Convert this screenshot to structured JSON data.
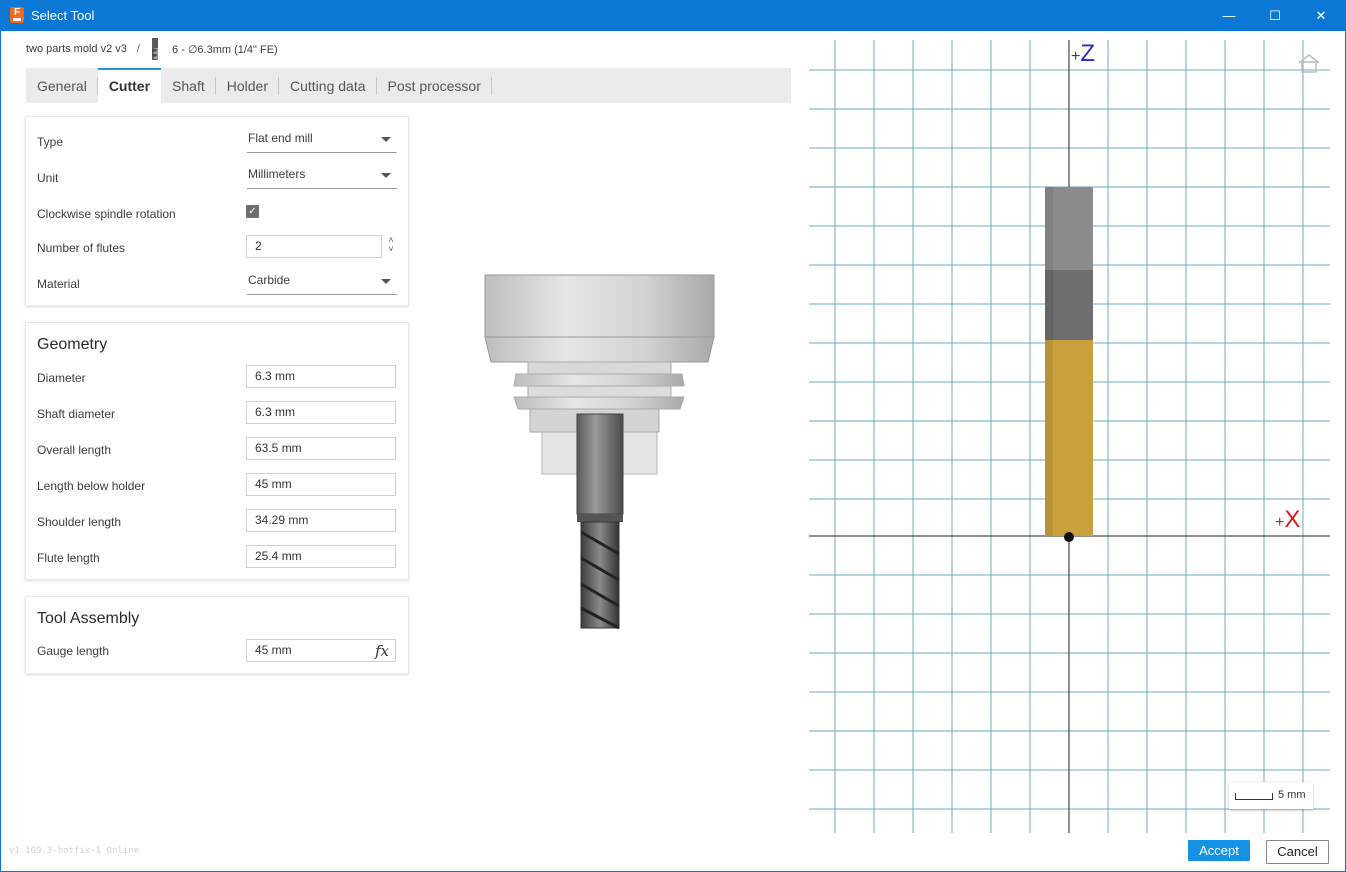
{
  "window": {
    "title": "Select Tool",
    "app_icon_letter": "F",
    "minimize_glyph": "—",
    "maximize_glyph": "☐",
    "close_glyph": "✕"
  },
  "breadcrumb": {
    "doc": "two parts mold v2 v3",
    "separator": "/",
    "tool": "6 - ∅6.3mm (1/4\" FE)"
  },
  "tabs": [
    {
      "label": "General",
      "active": false
    },
    {
      "label": "Cutter",
      "active": true
    },
    {
      "label": "Shaft",
      "active": false
    },
    {
      "label": "Holder",
      "active": false
    },
    {
      "label": "Cutting data",
      "active": false
    },
    {
      "label": "Post processor",
      "active": false
    }
  ],
  "cutter": {
    "type_label": "Type",
    "type_value": "Flat end mill",
    "unit_label": "Unit",
    "unit_value": "Millimeters",
    "clockwise_label": "Clockwise spindle rotation",
    "clockwise_checked": true,
    "check_glyph": "✓",
    "flutes_label": "Number of flutes",
    "flutes_value": "2",
    "spinner_up": "˄",
    "spinner_down": "˅",
    "material_label": "Material",
    "material_value": "Carbide"
  },
  "geometry": {
    "title": "Geometry",
    "fields": [
      {
        "label": "Diameter",
        "value": "6.3 mm"
      },
      {
        "label": "Shaft diameter",
        "value": "6.3 mm"
      },
      {
        "label": "Overall length",
        "value": "63.5 mm"
      },
      {
        "label": "Length below holder",
        "value": "45 mm"
      },
      {
        "label": "Shoulder length",
        "value": "34.29 mm"
      },
      {
        "label": "Flute length",
        "value": "25.4 mm"
      }
    ]
  },
  "assembly": {
    "title": "Tool Assembly",
    "gauge_label": "Gauge length",
    "gauge_value": "45 mm",
    "fx_glyph": "fx"
  },
  "version": "v1.109.3-hotfix-1 Online",
  "viewport": {
    "z_label": "Z",
    "x_label": "X",
    "plus": "+",
    "scale_label": "5 mm",
    "colors": {
      "grid": "#6fa8c6",
      "axis": "#222222",
      "z": "#2a2ad0",
      "x": "#e01818",
      "flute": "#c9a03c",
      "shaft_top": "#8b8b8b",
      "shaft_mid": "#6e6e6e"
    }
  },
  "buttons": {
    "accept": "Accept",
    "cancel": "Cancel"
  }
}
